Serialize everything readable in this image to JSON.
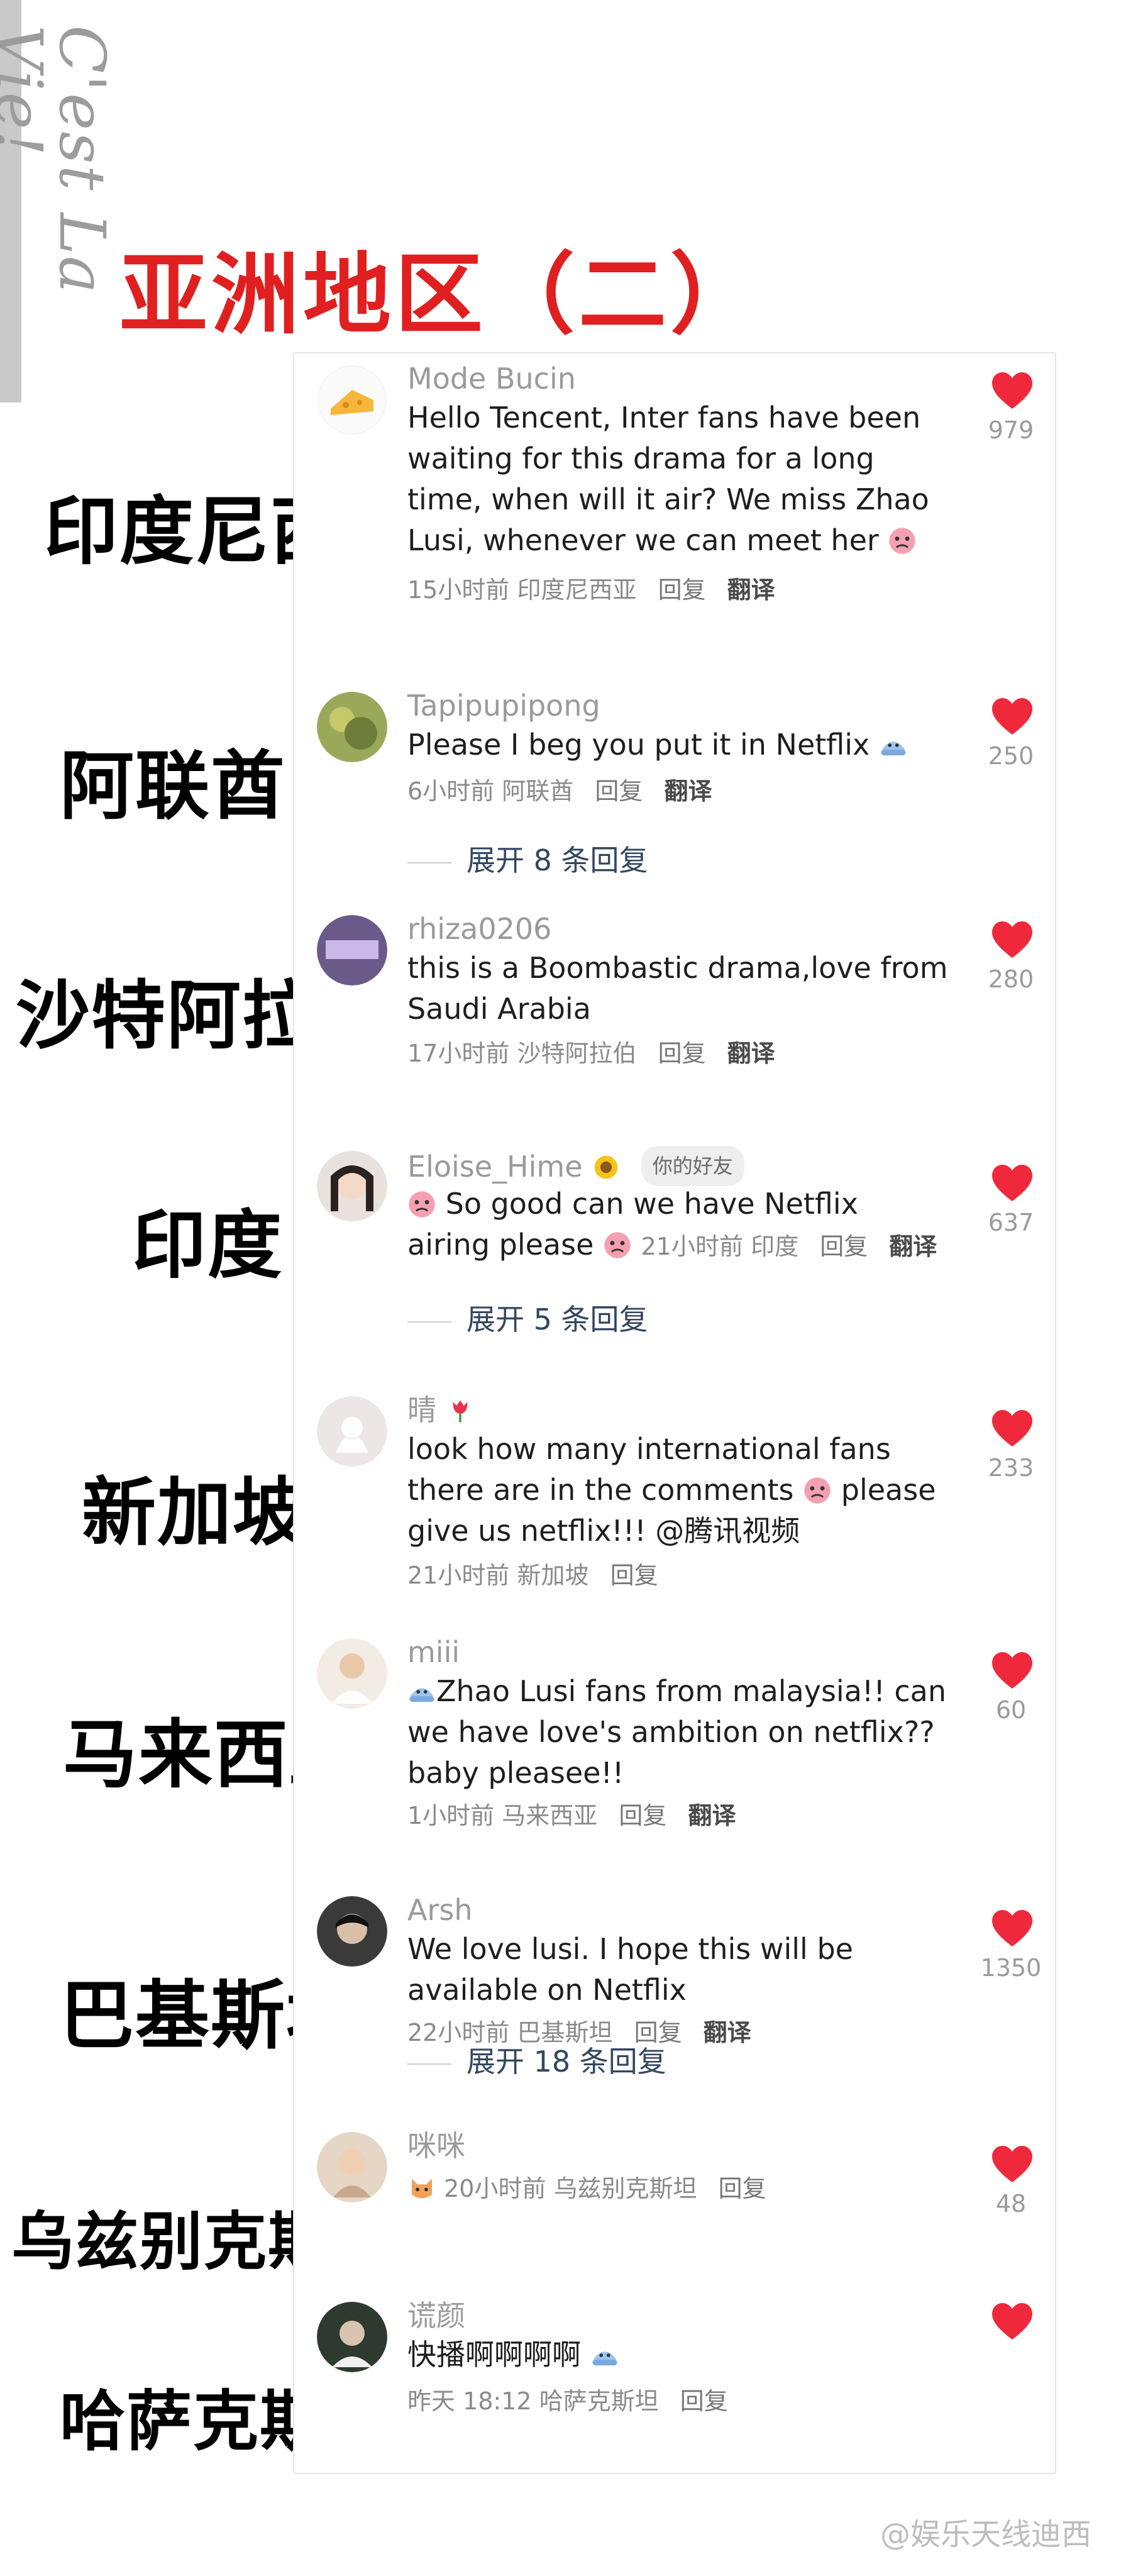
{
  "side_title": "C'est La Vie!",
  "main_title": "亚洲地区（二）",
  "country_labels": [
    "印度尼西亚",
    "阿联酋",
    "沙特阿拉伯",
    "印度",
    "新加坡",
    "马来西亚",
    "巴基斯坦",
    "乌兹别克斯坦",
    "哈萨克斯坦"
  ],
  "comments": [
    {
      "username": "Mode Bucin",
      "text": "Hello Tencent, Inter fans have been waiting for this drama for a long time, when will it air? We miss Zhao Lusi, whenever we can meet her",
      "time": "15小时前",
      "location": "印度尼西亚",
      "reply": "回复",
      "translate": "翻译",
      "likes": "979"
    },
    {
      "username": "Tapipupipong",
      "text": "Please I beg you put it in Netflix",
      "time": "6小时前",
      "location": "阿联酋",
      "reply": "回复",
      "translate": "翻译",
      "likes": "250",
      "expand": "展开 8 条回复"
    },
    {
      "username": "rhiza0206",
      "text": "this is a Boombastic drama,love from Saudi Arabia",
      "time": "17小时前",
      "location": "沙特阿拉伯",
      "reply": "回复",
      "translate": "翻译",
      "likes": "280"
    },
    {
      "username": "Eloise_Hime",
      "badge": "你的好友",
      "text": "So good can we have Netflix airing please",
      "time": "21小时前",
      "location": "印度",
      "reply": "回复",
      "translate": "翻译",
      "likes": "637",
      "expand": "展开 5 条回复"
    },
    {
      "username": "晴",
      "text": "look how many international fans there are in the comments",
      "text2": "please give us netflix!!! @腾讯视频",
      "time": "21小时前",
      "location": "新加坡",
      "reply": "回复",
      "likes": "233"
    },
    {
      "username": "miii",
      "text": "Zhao Lusi fans from malaysia!! can we have love's ambition on netflix?? baby pleasee!!",
      "time": "1小时前",
      "location": "马来西亚",
      "reply": "回复",
      "translate": "翻译",
      "likes": "60"
    },
    {
      "username": "Arsh",
      "text": "We love lusi. I hope this will be available on Netflix",
      "time": "22小时前",
      "location": "巴基斯坦",
      "reply": "回复",
      "translate": "翻译",
      "likes": "1350",
      "expand": "展开 18 条回复"
    },
    {
      "username": "咪咪",
      "time": "20小时前",
      "location": "乌兹别克斯坦",
      "reply": "回复",
      "likes": "48"
    },
    {
      "username": "谎颜",
      "text": "快播啊啊啊啊",
      "time": "昨天 18:12",
      "location": "哈萨克斯坦",
      "reply": "回复"
    }
  ],
  "watermark": "@娱乐天线迪西",
  "colors": {
    "title_red": "#e02020",
    "heart_red": "#f0283c",
    "link_blue": "#33475f"
  }
}
